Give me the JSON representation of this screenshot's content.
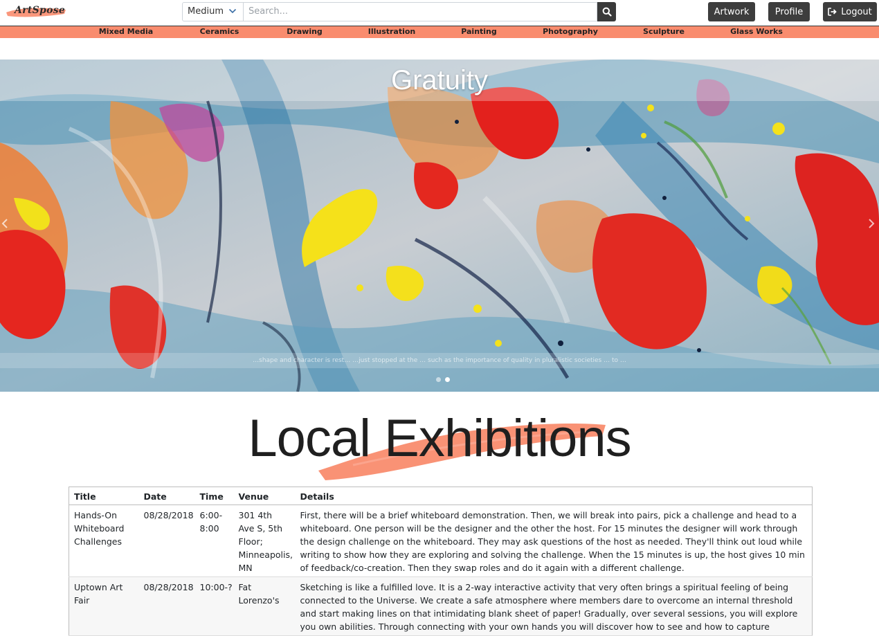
{
  "header": {
    "logo_text": "ArtSpose",
    "medium_select": "Medium",
    "search_placeholder": "Search...",
    "buttons": {
      "artwork": "Artwork",
      "profile": "Profile",
      "logout": "Logout"
    }
  },
  "categories": [
    "Mixed Media",
    "Ceramics",
    "Drawing",
    "Illustration",
    "Painting",
    "Photography",
    "Sculpture",
    "Glass Works"
  ],
  "hero": {
    "title": "Gratuity",
    "caption": "…shape and character is rest… …just stopped at the … such as the importance of quality in pluralistic societies … to …",
    "slide_count": 2,
    "active_slide": 1
  },
  "exhibitions": {
    "heading": "Local Exhibitions",
    "columns": [
      "Title",
      "Date",
      "Time",
      "Venue",
      "Details"
    ],
    "rows": [
      {
        "title": "Hands-On Whiteboard Challenges",
        "date": "08/28/2018",
        "time": "6:00-8:00",
        "venue": "301 4th Ave S, 5th Floor; Minneapolis, MN",
        "details": "First, there will be a brief whiteboard demonstration. Then, we will break into pairs, pick a challenge and head to a whiteboard. One person will be the designer and the other the host. For 15 minutes the designer will work through the design challenge on the whiteboard. They may ask questions of the host as needed. They'll think out loud while writing to show how they are exploring and solving the challenge. When the 15 minutes is up, the host gives 10 min of feedback/co-creation. Then they swap roles and do it again with a different challenge."
      },
      {
        "title": "Uptown Art Fair",
        "date": "08/28/2018",
        "time": "10:00-?",
        "venue": "Fat Lorenzo's",
        "details": "Sketching is like a fulfilled love. It is a 2-way interactive activity that very often brings a spiritual feeling of being connected to the Universe. We create a safe atmosphere where members dare to overcome an internal threshold and start making lines on that intimidating blank sheet of paper! Gradually, over several sessions, you will explore you own abilities. Through connecting with your own hands you will discover how to see and how to capture"
      }
    ]
  },
  "colors": {
    "accent": "#f98c6e",
    "button_dark": "#3d3d3d"
  }
}
